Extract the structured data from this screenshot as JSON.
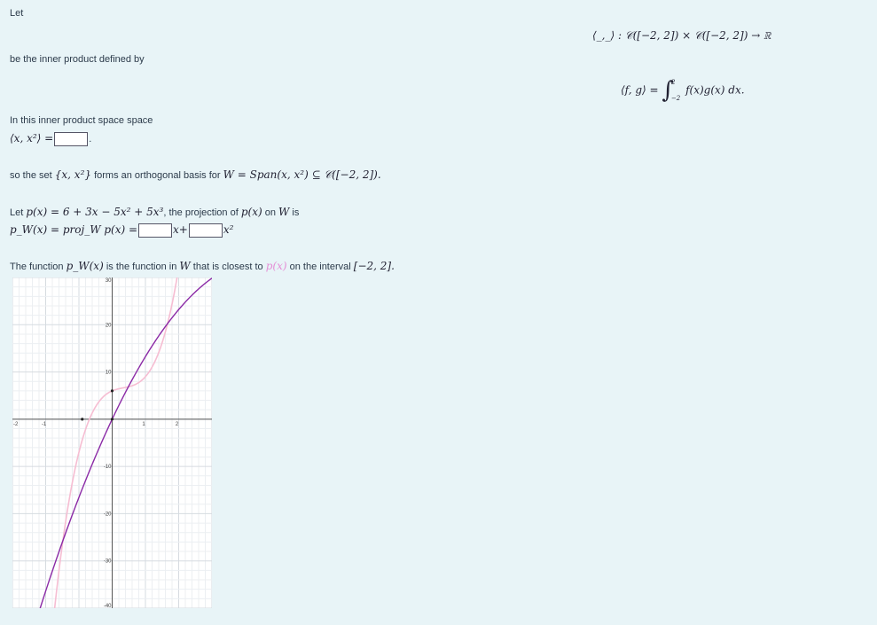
{
  "intro": {
    "let": "Let"
  },
  "inner_product_signature": "⟨_,_⟩ : 𝒞([−2, 2]) × 𝒞([−2, 2]) → ℝ",
  "defined_by": "be the inner product defined by",
  "formula": {
    "lhs": "⟨f, g⟩ =",
    "upper": "2",
    "lower": "−2",
    "integrand": "f(x)g(x) dx."
  },
  "space_text": "In this inner product space space",
  "q1": {
    "lhs": "⟨x, x²⟩ =",
    "tail": "."
  },
  "orthogonal_text": {
    "prefix": "so the set",
    "set": "{x, x²}",
    "middle": "forms an orthogonal basis for",
    "span": "W = Span(x, x²) ⊆ 𝒞([−2, 2])."
  },
  "projection_text": {
    "prefix": "Let",
    "p_def": "p(x) = 6 + 3x − 5x² + 5x³",
    "middle": ", the projection of",
    "p": "p(x)",
    "on": "on",
    "W": "W",
    "is": "is"
  },
  "q2": {
    "lhs": "p_W(x) = proj_W p(x) =",
    "term1": "x+",
    "term2": "x²"
  },
  "closest_text": {
    "prefix": "The function",
    "pw": "p_W(x)",
    "middle": "is the function in",
    "W": "W",
    "mid2": "that is closest to",
    "p": "p(x)",
    "suffix": "on the interval",
    "interval": "[−2, 2]."
  },
  "chart_data": {
    "type": "line",
    "xlim": [
      -3,
      3
    ],
    "ylim": [
      -40,
      30
    ],
    "grid": true,
    "x_ticks": [
      {
        "value": -3,
        "label": "-2"
      },
      {
        "value": -2,
        "label": "-1"
      },
      {
        "value": 0,
        "label": ""
      },
      {
        "value": 1,
        "label": "1"
      },
      {
        "value": 2,
        "label": "2"
      }
    ],
    "y_ticks": [
      {
        "value": 30,
        "label": "30"
      },
      {
        "value": 20,
        "label": "20"
      },
      {
        "value": 10,
        "label": "10"
      },
      {
        "value": -10,
        "label": "-10"
      },
      {
        "value": -20,
        "label": "-20"
      },
      {
        "value": -30,
        "label": "-30"
      },
      {
        "value": -40,
        "label": "-40"
      }
    ],
    "series": [
      {
        "color": "#f6bdd2",
        "formula": "6 + 3x - 5x^2 + 5x^3",
        "samples": 140
      },
      {
        "color": "#8b2aa6",
        "formula": "a*x + b*x^2",
        "coeffs": [
          14.9,
          -1.65
        ],
        "samples": 140
      }
    ],
    "points": [
      {
        "x": 0,
        "y": 6
      },
      {
        "x": -0.9,
        "y": 0
      },
      {
        "x": 0,
        "y": 0
      }
    ],
    "colors": {
      "axis": "#555555",
      "grid_major": "#d6dbe0",
      "grid_minor": "#eceff2",
      "point": "#222222",
      "background": "#ffffff"
    }
  }
}
